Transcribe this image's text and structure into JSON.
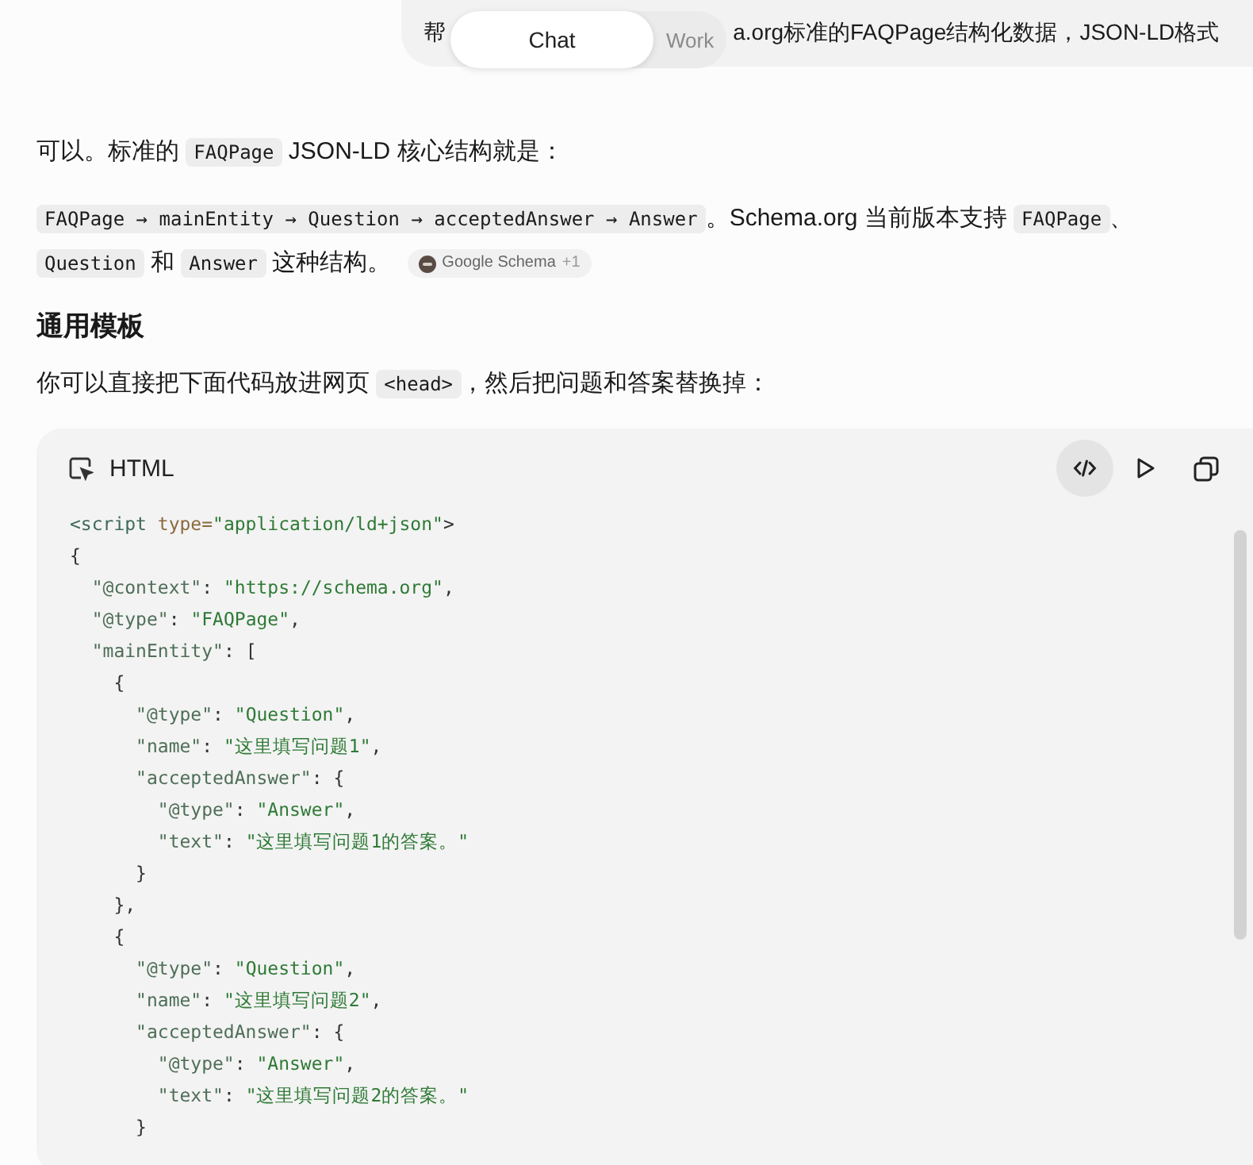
{
  "top_bar": {
    "message_start": "帮",
    "message_end": "a.org标准的FAQPage结构化数据，JSON-LD格式",
    "mode_tabs": [
      {
        "label": "Chat",
        "selected": true
      },
      {
        "label": "Work",
        "selected": false
      }
    ]
  },
  "answer": {
    "blocks": [
      {
        "kind": "paragraph",
        "segments": [
          {
            "kind": "text",
            "text": "可以。标准的 "
          },
          {
            "kind": "code",
            "text": "FAQPage"
          },
          {
            "kind": "text",
            "text": " JSON-LD 核心结构就是："
          }
        ]
      },
      {
        "kind": "paragraph",
        "segments": [
          {
            "kind": "code",
            "text": "FAQPage → mainEntity → Question → acceptedAnswer → Answer"
          },
          {
            "kind": "text",
            "text": "。Schema.org 当前版本支持 "
          },
          {
            "kind": "code",
            "text": "FAQPage"
          },
          {
            "kind": "text",
            "text": "、 "
          },
          {
            "kind": "code",
            "text": "Question"
          },
          {
            "kind": "text",
            "text": " 和 "
          },
          {
            "kind": "code",
            "text": "Answer"
          },
          {
            "kind": "text",
            "text": " 这种结构。"
          }
        ],
        "source": {
          "label": "Google Schema",
          "count": "+1"
        }
      },
      {
        "kind": "heading",
        "text": "通用模板"
      },
      {
        "kind": "paragraph",
        "segments": [
          {
            "kind": "text",
            "text": "你可以直接把下面代码放进网页 "
          },
          {
            "kind": "code",
            "text": "<head>"
          },
          {
            "kind": "text",
            "text": "，然后把问题和答案替换掉："
          }
        ]
      }
    ],
    "code_block": {
      "language": "HTML",
      "toolbar": [
        {
          "kind": "code",
          "selected": true
        },
        {
          "kind": "run",
          "selected": false
        },
        {
          "kind": "copy",
          "selected": false
        }
      ],
      "lines": [
        "<script type=\"application/ld+json\">",
        "{",
        "  \"@context\": \"https://schema.org\",",
        "  \"@type\": \"FAQPage\",",
        "  \"mainEntity\": [",
        "    {",
        "      \"@type\": \"Question\",",
        "      \"name\": \"这里填写问题1\",",
        "      \"acceptedAnswer\": {",
        "        \"@type\": \"Answer\",",
        "        \"text\": \"这里填写问题1的答案。\"",
        "      }",
        "    },",
        "    {",
        "      \"@type\": \"Question\",",
        "      \"name\": \"这里填写问题2\",",
        "      \"acceptedAnswer\": {",
        "        \"@type\": \"Answer\",",
        "        \"text\": \"这里填写问题2的答案。\"",
        "      }"
      ]
    }
  }
}
